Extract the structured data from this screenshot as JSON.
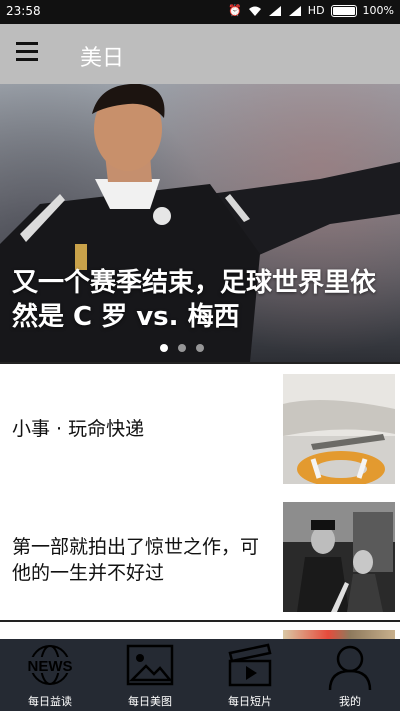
{
  "status_bar": {
    "time": "23:58",
    "network": "HD",
    "battery": "100%"
  },
  "app_bar": {
    "title": "美日"
  },
  "hero": {
    "caption": "又一个赛季结束，足球世界里依然是 C 罗 vs. 梅西",
    "pager_count": 3,
    "active_index": 0
  },
  "articles": [
    {
      "title": "小事 · 玩命快递"
    },
    {
      "title": "第一部就拍出了惊世之作，可他的一生并不好过"
    }
  ],
  "bottom_nav": {
    "items": [
      {
        "label": "每日益读",
        "icon": "news-icon"
      },
      {
        "label": "每日美图",
        "icon": "image-icon"
      },
      {
        "label": "每日短片",
        "icon": "video-icon"
      },
      {
        "label": "我的",
        "icon": "profile-icon"
      }
    ]
  },
  "colors": {
    "app_bar": "#bdbdbd",
    "status_bar": "#111111",
    "bottom_nav": "#252a33"
  }
}
